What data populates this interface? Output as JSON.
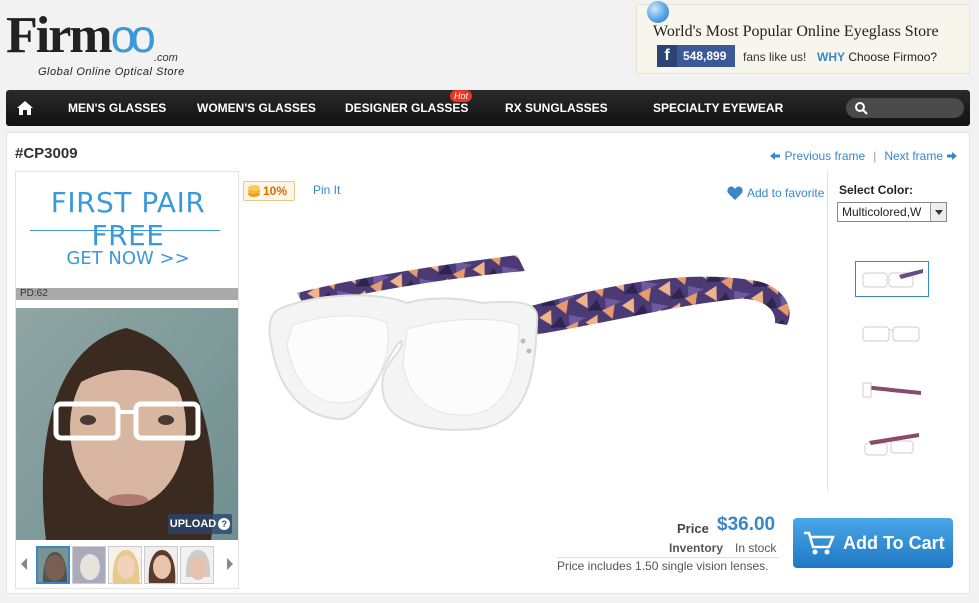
{
  "header": {
    "logo_main": "Firm",
    "logo_oo": "oo",
    "logo_com": ".com",
    "logo_tagline": "Global Online Optical Store",
    "promo_title": "World's Most Popular Online Eyeglass Store",
    "fb_count": "548,899",
    "fans_text": "fans like us!",
    "why_label": "WHY",
    "choose_label": "Choose Firmoo?"
  },
  "nav": {
    "items": [
      {
        "label": "MEN'S GLASSES"
      },
      {
        "label": "WOMEN'S GLASSES"
      },
      {
        "label": "DESIGNER GLASSES"
      },
      {
        "label": "RX SUNGLASSES"
      },
      {
        "label": "SPECIALTY EYEWEAR"
      }
    ],
    "hot_badge": "Hot",
    "search_placeholder": ""
  },
  "product": {
    "sku": "#CP3009",
    "prev_label": "Previous frame",
    "sep": "|",
    "next_label": "Next frame",
    "coins_label": "10%",
    "pin_label": "Pin It",
    "favorite_label": "Add to favorite",
    "color_label": "Select Color:",
    "color_value": "Multicolored,W",
    "price_label": "Price",
    "price_value": "$36.00",
    "inventory_label": "Inventory",
    "inventory_value": "In stock",
    "price_note": "Price includes 1.50 single vision lenses.",
    "cart_label": "Add To Cart"
  },
  "left": {
    "promo_title": "FIRST PAIR FREE",
    "promo_cta": "GET NOW >>",
    "pd_label": "PD:62",
    "upload_label": "UPLOAD",
    "upload_q": "?"
  },
  "colors": {
    "accent": "#3a87c8",
    "nav_bg": "#1a1a1a",
    "price": "#3a87c8"
  }
}
